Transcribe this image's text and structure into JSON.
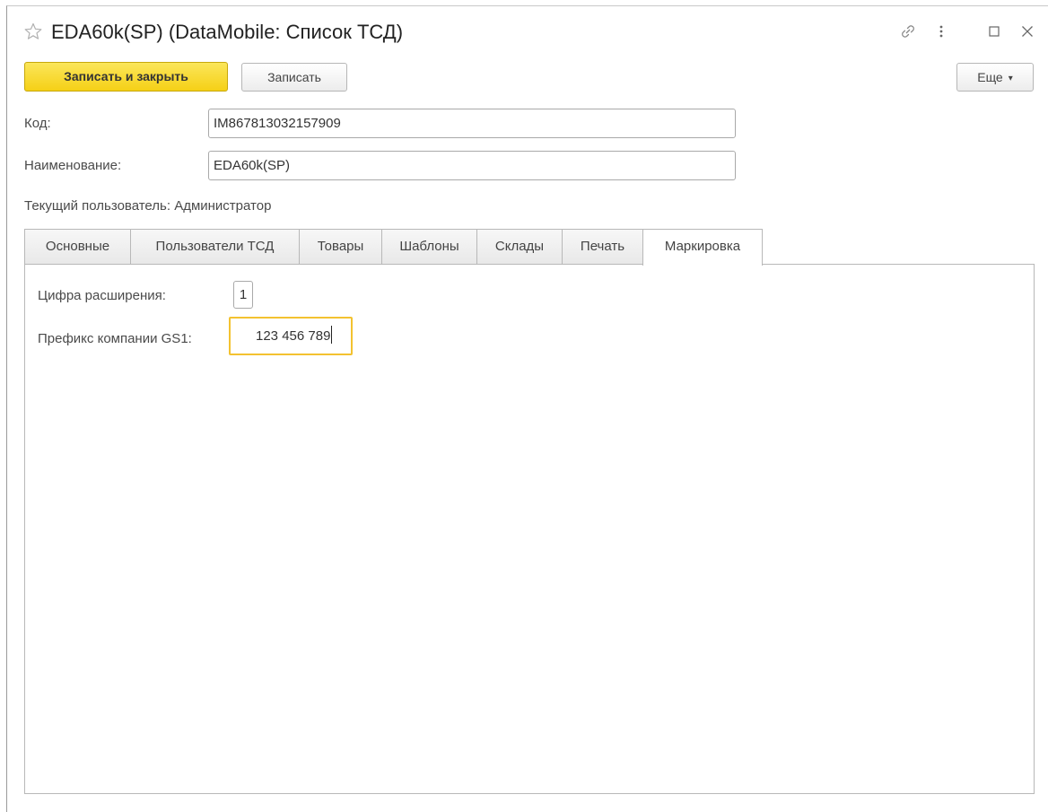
{
  "window": {
    "title": "EDA60k(SP) (DataMobile: Список ТСД)"
  },
  "toolbar": {
    "save_close_label": "Записать и закрыть",
    "save_label": "Записать",
    "more_label": "Еще"
  },
  "fields": {
    "code_label": "Код:",
    "code_value": "IM867813032157909",
    "name_label": "Наименование:",
    "name_value": "EDA60k(SP)",
    "current_user_label": "Текущий пользователь:",
    "current_user_value": "Администратор"
  },
  "tabs": [
    {
      "label": "Основные"
    },
    {
      "label": "Пользователи ТСД"
    },
    {
      "label": "Товары"
    },
    {
      "label": "Шаблоны"
    },
    {
      "label": "Склады"
    },
    {
      "label": "Печать"
    },
    {
      "label": "Маркировка"
    }
  ],
  "active_tab": "Маркировка",
  "marking": {
    "extension_digit_label": "Цифра расширения:",
    "extension_digit_value": "1",
    "gs1_prefix_label": "Префикс компании GS1:",
    "gs1_prefix_value": "123 456 789"
  },
  "colors": {
    "primary_button": "#f5d016",
    "focus_border": "#f3c230"
  },
  "icons": {
    "favorite": "star-icon",
    "link": "link-icon",
    "menu": "more-vertical-icon",
    "maximize": "maximize-icon",
    "close": "close-icon",
    "more_dropdown": "chevron-down-icon"
  }
}
